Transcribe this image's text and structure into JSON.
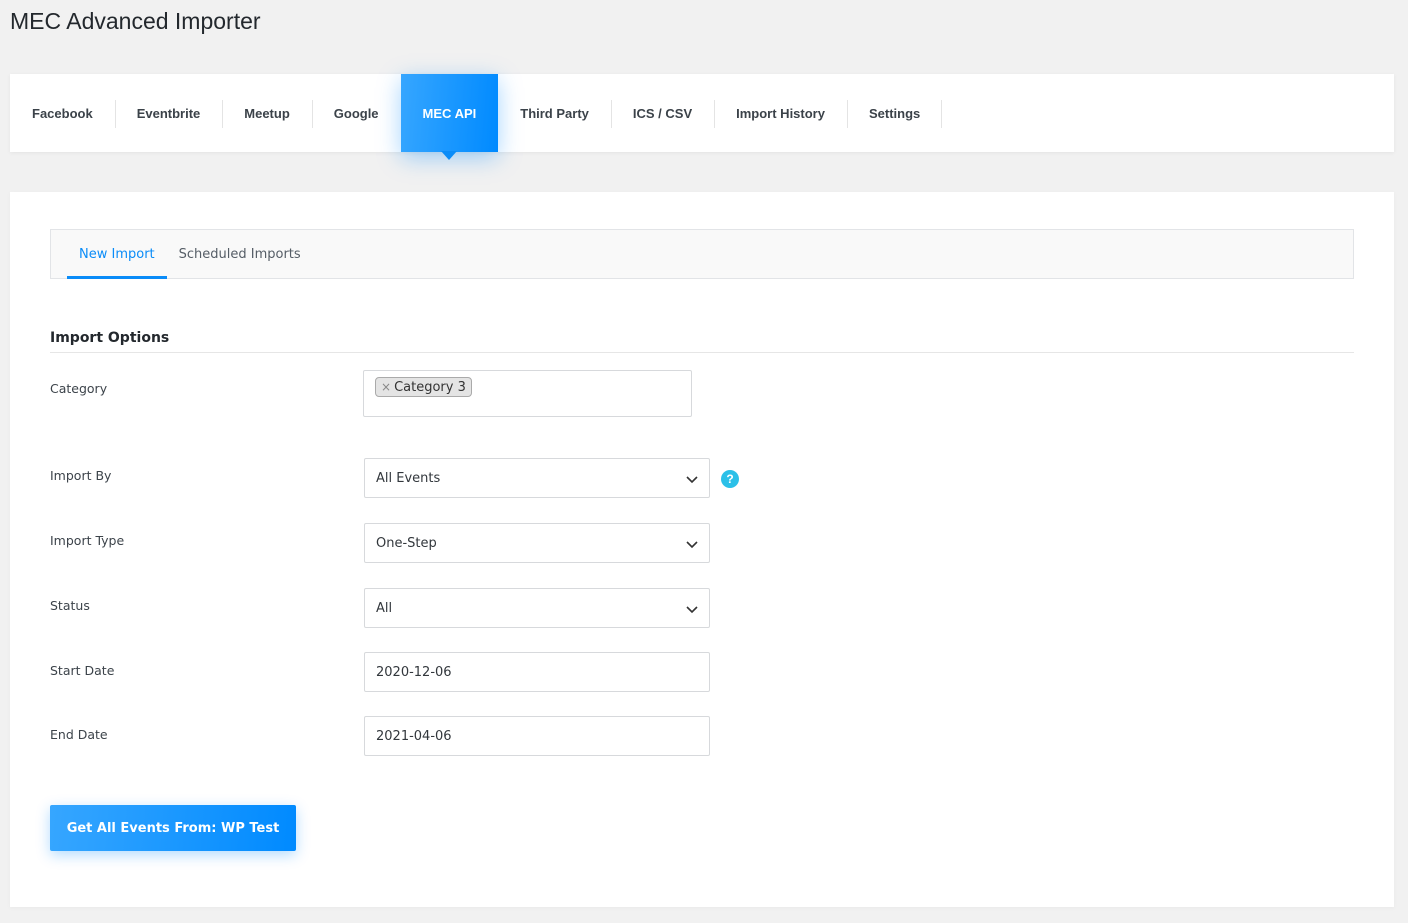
{
  "page": {
    "title": "MEC Advanced Importer"
  },
  "main_nav": {
    "items": [
      {
        "label": "Facebook"
      },
      {
        "label": "Eventbrite"
      },
      {
        "label": "Meetup"
      },
      {
        "label": "Google"
      },
      {
        "label": "MEC API",
        "active": true
      },
      {
        "label": "Third Party"
      },
      {
        "label": "ICS / CSV"
      },
      {
        "label": "Import History"
      },
      {
        "label": "Settings"
      }
    ]
  },
  "subtabs": {
    "items": [
      {
        "label": "New Import",
        "active": true
      },
      {
        "label": "Scheduled Imports"
      }
    ]
  },
  "form": {
    "section_title": "Import Options",
    "category": {
      "label": "Category",
      "chip_remove": "×",
      "selected": "Category 3"
    },
    "import_by": {
      "label": "Import By",
      "value": "All Events",
      "help": "?"
    },
    "import_type": {
      "label": "Import Type",
      "value": "One-Step"
    },
    "status": {
      "label": "Status",
      "value": "All"
    },
    "start_date": {
      "label": "Start Date",
      "value": "2020-12-06"
    },
    "end_date": {
      "label": "End Date",
      "value": "2021-04-06"
    },
    "submit_label": "Get All Events From: WP Test"
  },
  "colors": {
    "accent": "#008aff",
    "accent_light": "#36a6ff",
    "help": "#2bc0e8"
  },
  "icons": {
    "select_arrow": "chevron-down-icon",
    "help": "help-icon"
  }
}
